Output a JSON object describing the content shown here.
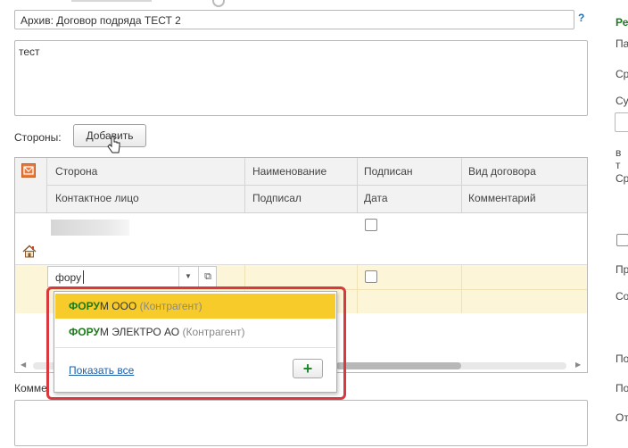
{
  "form": {
    "title_value": "Архив: Договор подряда ТЕСТ 2",
    "help_label": "?",
    "memo_value": "тест"
  },
  "sides": {
    "label": "Стороны:",
    "add_button": "Добавить"
  },
  "table": {
    "header_row1": [
      "Сторона",
      "Наименование",
      "Подписан",
      "Вид договора"
    ],
    "header_row2": [
      "Контактное лицо",
      "Подписал",
      "Дата",
      "Комментарий"
    ],
    "rows": [
      {
        "party": "",
        "signed": false
      },
      {
        "party_input": "фору",
        "signed": false
      }
    ]
  },
  "autocomplete": {
    "items": [
      {
        "match": "ФОРУ",
        "rest": "М ООО",
        "type": "(Контрагент)",
        "selected": true
      },
      {
        "match": "ФОРУ",
        "rest": "М ЭЛЕКТРО АО",
        "type": "(Контрагент)",
        "selected": false
      }
    ],
    "show_all": "Показать все",
    "add_label": "+"
  },
  "comment": {
    "label": "Комме"
  },
  "right_panel": {
    "items": [
      "Ре",
      "Па",
      "Ср",
      "Су",
      "в т",
      "Ср",
      "Пр",
      "Со",
      "По",
      "По",
      "От"
    ]
  },
  "colors": {
    "accent_green": "#1b7a1b",
    "selection_yellow": "#f7cc2a",
    "highlight_frame": "#d9393e",
    "row_highlight": "#fdf5d8",
    "link_blue": "#1a5fa8"
  }
}
